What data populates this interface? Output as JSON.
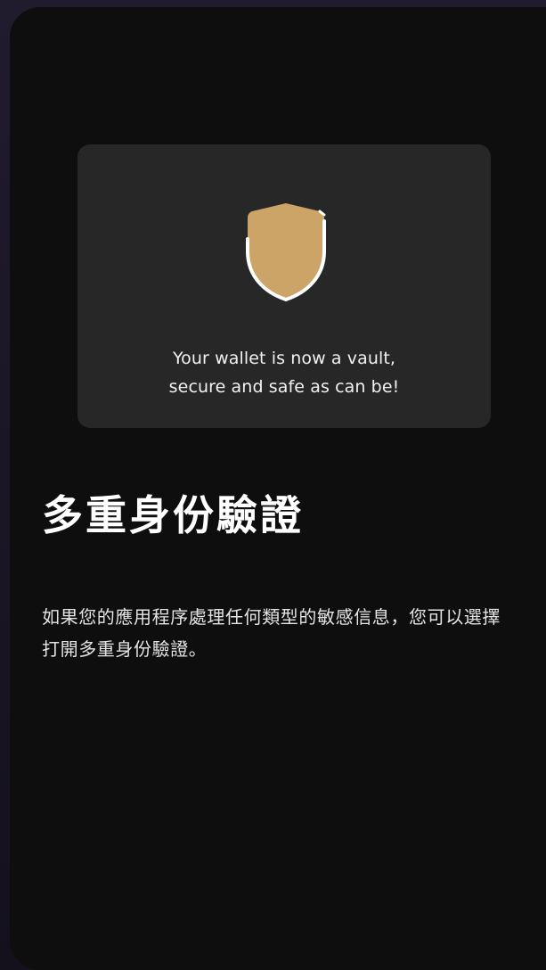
{
  "card": {
    "icon": "shield-icon",
    "caption_line1": "Your wallet is now a vault,",
    "caption_line2": "secure and safe as can be!"
  },
  "title": "多重身份驗證",
  "description": "如果您的應用程序處理任何類型的敏感信息，您可以選擇打開多重身份驗證。",
  "colors": {
    "screen_background": "#0e0e0f",
    "card_background": "#272727",
    "shield_fill": "#cda467",
    "shield_outline": "#ffffff"
  }
}
